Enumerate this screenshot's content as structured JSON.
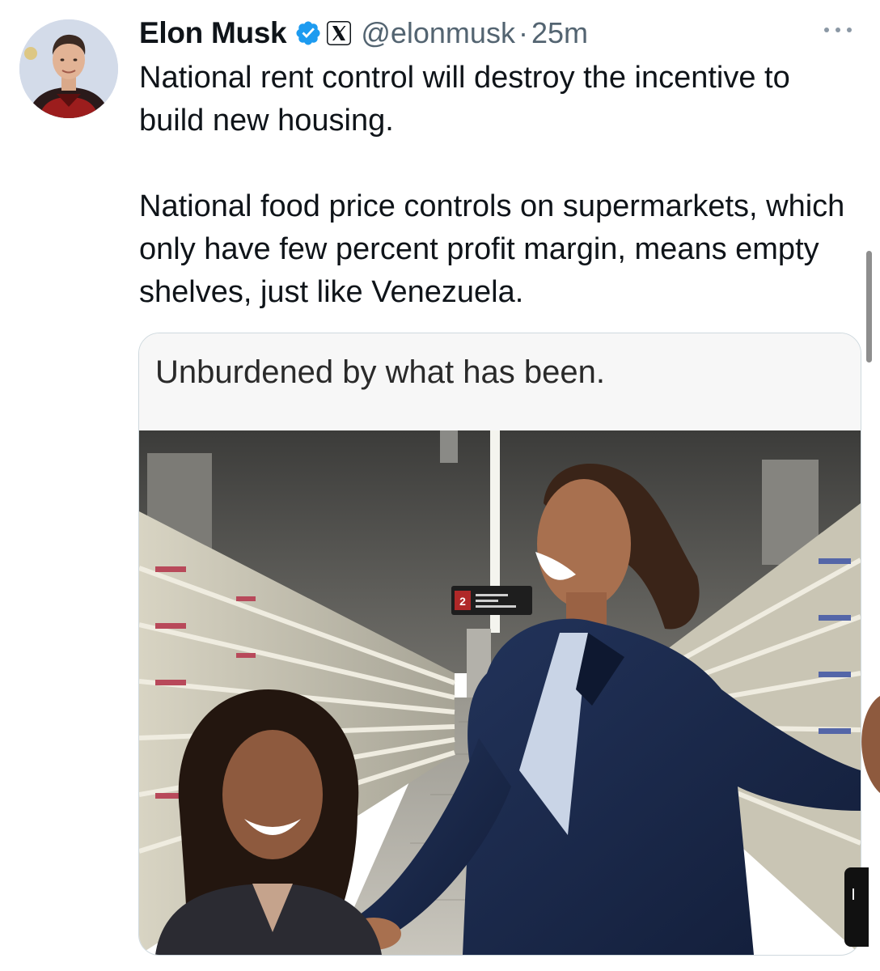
{
  "author": {
    "display_name": "Elon Musk",
    "handle": "@elonmusk",
    "separator": "·",
    "timestamp": "25m",
    "verified_color": "#1d9bf0"
  },
  "tweet": {
    "paragraphs": [
      "National rent control will destroy the incentive to build new housing.",
      "National food price controls on supermarkets, which only have few percent profit margin, means empty shelves, just like Venezuela."
    ]
  },
  "media": {
    "caption": "Unburdened by what has been.",
    "aisle_sign_number": "2"
  },
  "icons": {
    "verified": "verified-badge-icon",
    "affiliation": "x-logo-icon",
    "more": "more-options-icon"
  },
  "colors": {
    "text_primary": "#0f1419",
    "text_secondary": "#536471",
    "border": "#cfd9de",
    "suit": "#1b2a4a"
  }
}
